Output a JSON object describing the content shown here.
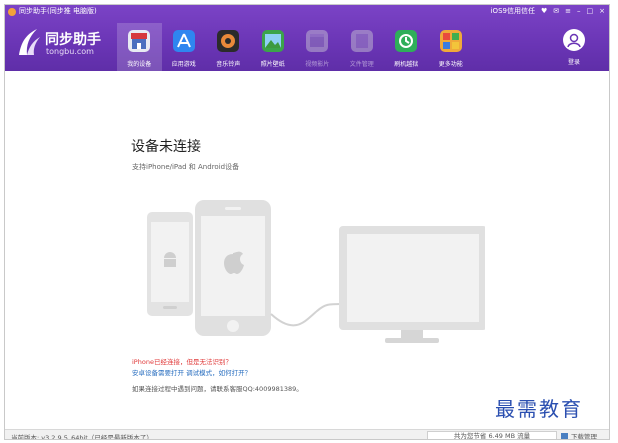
{
  "window": {
    "title": "同步助手(同步推 电脑版)",
    "controls": [
      "iOS9信用信任",
      "♥",
      "✉",
      "≡",
      "–",
      "□",
      "×"
    ]
  },
  "brand": {
    "name": "同步助手",
    "sub": "tongbu.com"
  },
  "nav": {
    "items": [
      {
        "label": "我的设备",
        "icon": "my-device-icon",
        "color": "#e7eaf2",
        "active": true
      },
      {
        "label": "应用游戏",
        "icon": "app-store-icon",
        "color": "#2f86f0"
      },
      {
        "label": "音乐铃声",
        "icon": "music-icon",
        "color": "#2b2b2b"
      },
      {
        "label": "照片壁纸",
        "icon": "photo-icon",
        "color": "#3ba44a"
      },
      {
        "label": "视频影片",
        "icon": "video-icon",
        "color": "#cfcfd6",
        "disabled": true
      },
      {
        "label": "文件管理",
        "icon": "file-icon",
        "color": "#cfcfd6",
        "disabled": true
      },
      {
        "label": "刷机越狱",
        "icon": "flash-icon",
        "color": "#2fae5a"
      },
      {
        "label": "更多功能",
        "icon": "more-icon",
        "color": "#f0a93a"
      }
    ],
    "login_label": "登录"
  },
  "main": {
    "heading": "设备未连接",
    "subheading": "支持iPhone/iPad 和 Android设备",
    "help_red": "iPhone已经连接，但是无法识别？",
    "help_blue": "安卓设备需要打开 调试模式，如何打开？",
    "help_contact": "如果连接过程中遇到问题，请联系客服QQ:4009981389。"
  },
  "status": {
    "version": "当前版本: v3.2.9.5_64bit（已经是最新版本了）",
    "saved": "共为您节省  6.49 MB 流量",
    "download": "下载管理"
  },
  "watermark": "最需教育"
}
